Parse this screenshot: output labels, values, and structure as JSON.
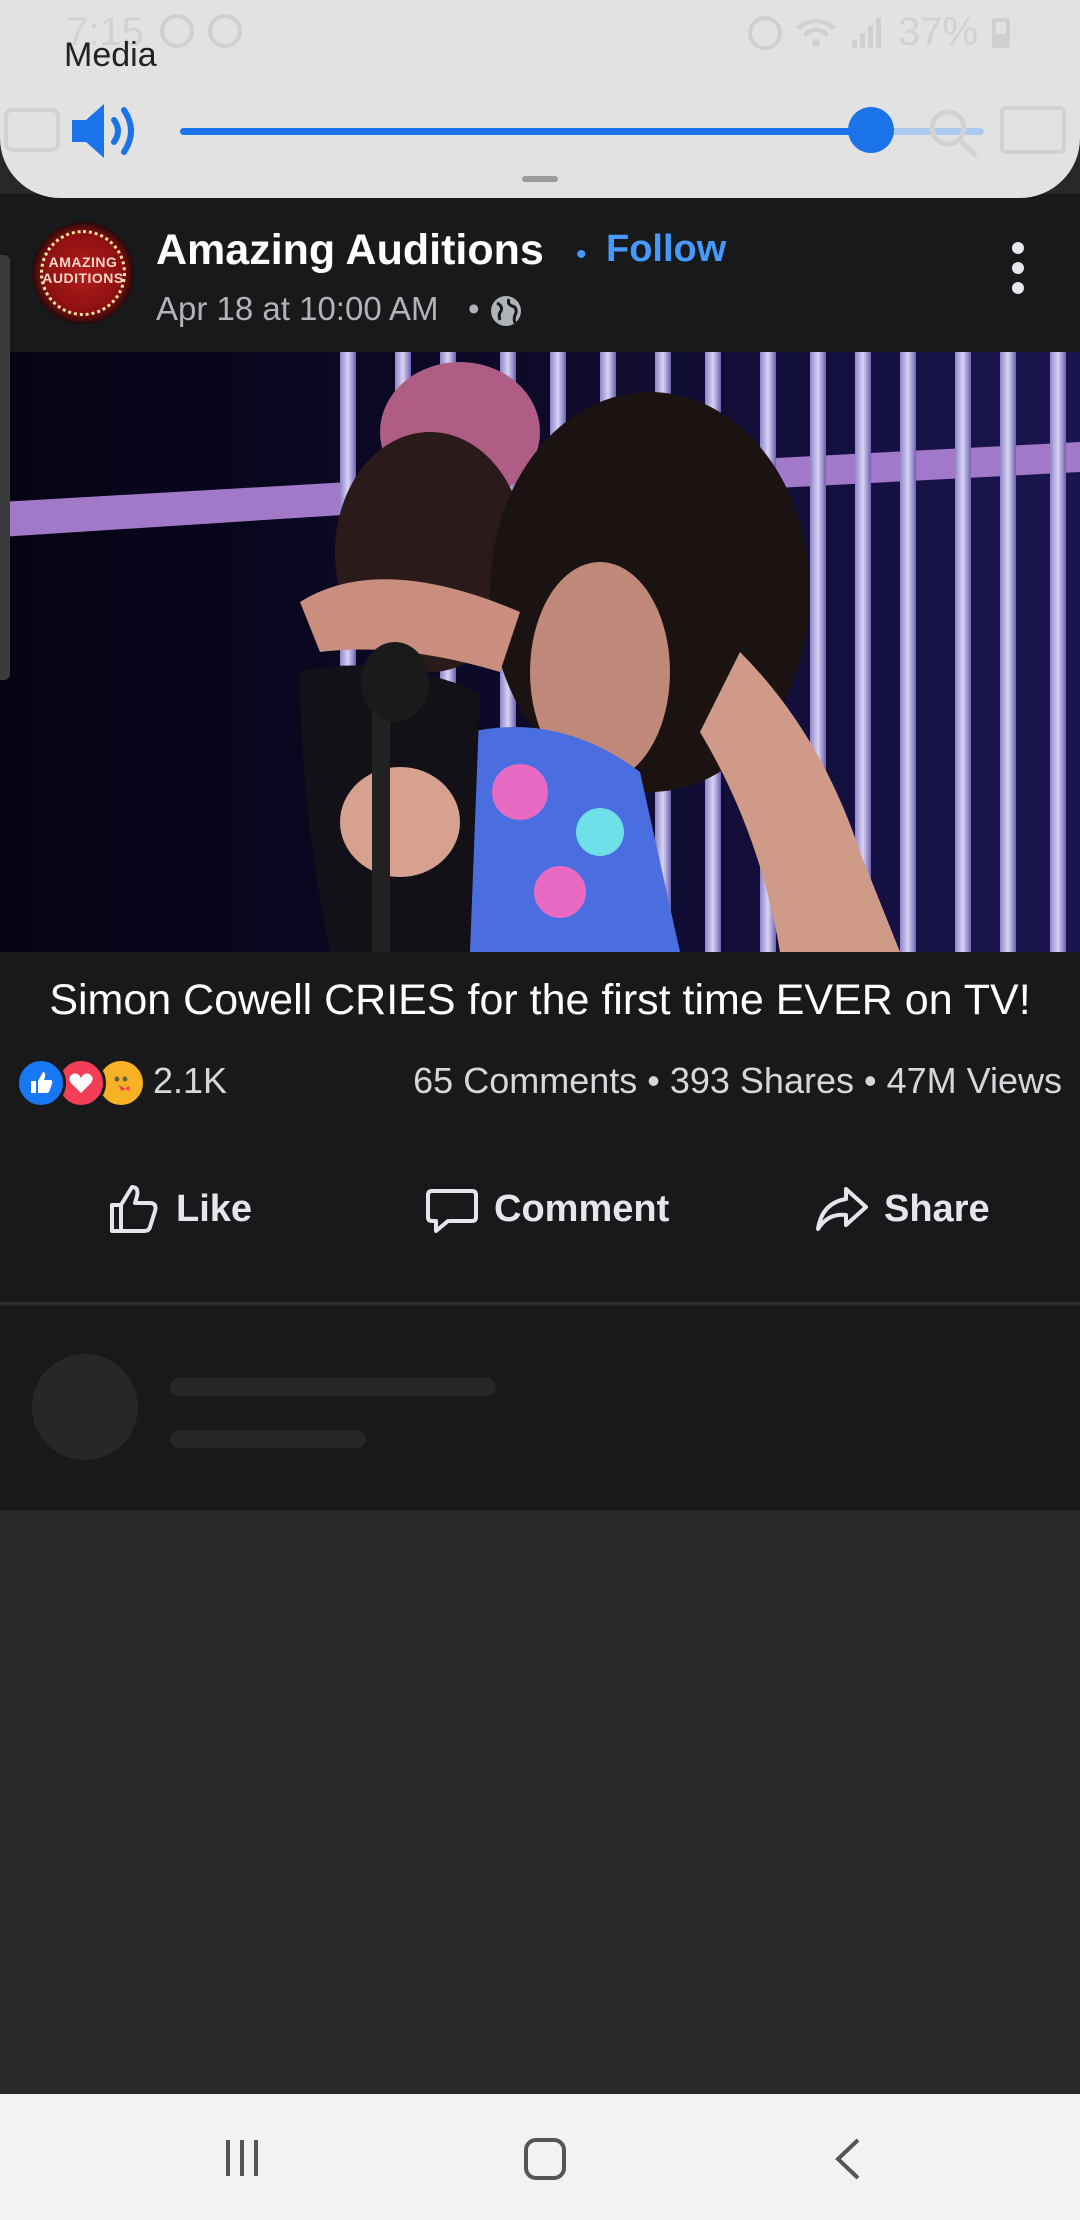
{
  "status_bar": {
    "time": "7:15",
    "battery": "37%"
  },
  "volume_panel": {
    "label": "Media",
    "level": 0.86,
    "accent_color": "#1a73e8",
    "icons": [
      "speaker-icon",
      "search-icon",
      "cast-icon"
    ]
  },
  "post": {
    "page_name": "Amazing Auditions",
    "avatar_text": "AMAZING AUDITIONS",
    "follow_label": "Follow",
    "timestamp": "Apr 18 at 10:00 AM",
    "privacy_icon": "globe-icon",
    "caption": "Simon Cowell CRIES for the first time EVER on TV!",
    "reactions": [
      "like",
      "love",
      "care"
    ],
    "reaction_count": "2.1K",
    "stats": "65 Comments • 393 Shares • 47M Views",
    "actions": {
      "like": "Like",
      "comment": "Comment",
      "share": "Share"
    }
  },
  "colors": {
    "link": "#4599ff",
    "card_bg": "#18191a",
    "page_bg": "#282828"
  }
}
